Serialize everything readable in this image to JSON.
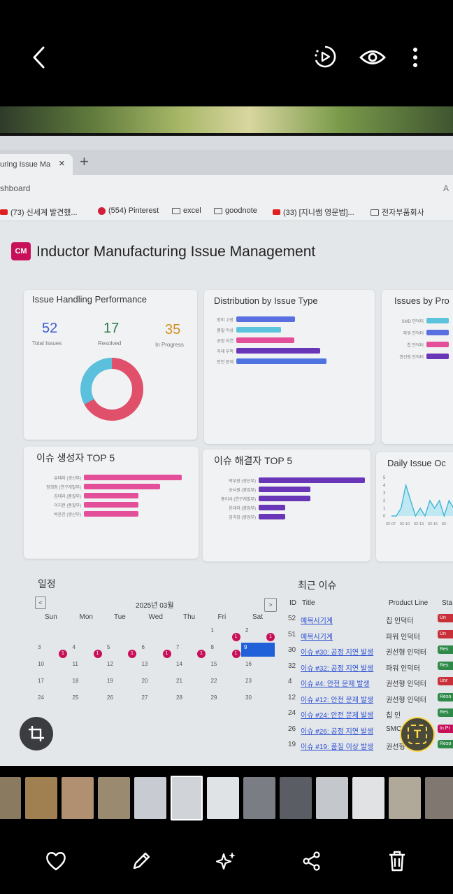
{
  "browser": {
    "tab_title": "uring Issue Ma",
    "tab_close": "×",
    "new_tab": "+",
    "address": "shboard",
    "address_right": "A",
    "bookmarks": [
      {
        "icon": "youtube-icon",
        "label": "(73) 신세계 발견했..."
      },
      {
        "icon": "pinterest-icon",
        "label": "(554) Pinterest"
      },
      {
        "icon": "folder-icon",
        "label": "excel"
      },
      {
        "icon": "folder-icon",
        "label": "goodnote"
      },
      {
        "icon": "youtube-icon",
        "label": "(33) [지니쌤 영문법]..."
      },
      {
        "icon": "folder-icon",
        "label": "전자부품회사"
      }
    ]
  },
  "app": {
    "logo": "CM",
    "title": "Inductor Manufacturing Issue Management"
  },
  "performance": {
    "title": "Issue Handling Performance",
    "total": "52",
    "total_label": "Total Issues",
    "resolved": "17",
    "resolved_label": "Resolved",
    "in_progress": "35",
    "in_progress_label": "In Progress",
    "donut": {
      "resolved_fraction": 0.33,
      "in_progress_fraction": 0.67
    }
  },
  "by_type": {
    "title": "Distribution by Issue Type",
    "items": [
      {
        "label": "장비 고장",
        "value": 0.6,
        "color": "#5a6fe0"
      },
      {
        "label": "품질 이상",
        "value": 0.46,
        "color": "#5bc4dc"
      },
      {
        "label": "공정 지연",
        "value": 0.59,
        "color": "#e44f9a"
      },
      {
        "label": "자재 부족",
        "value": 0.86,
        "color": "#6a36b8"
      },
      {
        "label": "안전 문제",
        "value": 0.92,
        "color": "#4f74e0"
      }
    ]
  },
  "by_product": {
    "title": "Issues by Pro",
    "items": [
      {
        "label": "SMD 인덕터",
        "value": 0.9,
        "color": "#5bc4dc"
      },
      {
        "label": "파워 인덕터",
        "value": 0.9,
        "color": "#5a6fe0"
      },
      {
        "label": "칩 인덕터",
        "value": 0.9,
        "color": "#e44f9a"
      },
      {
        "label": "권선형 인덕터",
        "value": 0.9,
        "color": "#6a36b8"
      }
    ]
  },
  "creators": {
    "title": "이슈 생성자 TOP 5",
    "items": [
      {
        "label": "유태리 (생산부)",
        "value": 1.0
      },
      {
        "label": "정희정 (연구개발부)",
        "value": 0.78
      },
      {
        "label": "김태리 (품질부)",
        "value": 0.56
      },
      {
        "label": "이지현 (품질부)",
        "value": 0.56
      },
      {
        "label": "박윤진 (생산부)",
        "value": 0.56
      }
    ]
  },
  "resolvers": {
    "title": "이슈 해결자 TOP 5",
    "items": [
      {
        "label": "박부장 (생산부)",
        "value": 1.0
      },
      {
        "label": "송사원 (영업부)",
        "value": 0.49
      },
      {
        "label": "홍이사 (연구개발부)",
        "value": 0.49
      },
      {
        "label": "윤대리 (영업부)",
        "value": 0.25
      },
      {
        "label": "김과장 (영업부)",
        "value": 0.25
      }
    ]
  },
  "daily": {
    "title": "Daily Issue Oc",
    "y_ticks": [
      "5",
      "4",
      "3",
      "2",
      "1",
      "0"
    ],
    "x_ticks": [
      "02-07",
      "02-10",
      "02-13",
      "02-16",
      "02-"
    ],
    "values": [
      0,
      0,
      1,
      4,
      2,
      0,
      1,
      0,
      2,
      1,
      2,
      0,
      2,
      1,
      0
    ]
  },
  "calendar": {
    "title": "일정",
    "month": "2025년 03월",
    "prev": "<",
    "next": ">",
    "weekdays": [
      "Sun",
      "Mon",
      "Tue",
      "Wed",
      "Thu",
      "Fri",
      "Sat"
    ],
    "weeks": [
      [
        "",
        "",
        "",
        "",
        "",
        "1",
        "2"
      ],
      [
        "3",
        "4",
        "5",
        "6",
        "7",
        "8",
        "9"
      ],
      [
        "10",
        "11",
        "12",
        "13",
        "14",
        "15",
        "16"
      ],
      [
        "17",
        "18",
        "19",
        "20",
        "21",
        "22",
        "23"
      ],
      [
        "24",
        "25",
        "26",
        "27",
        "28",
        "29",
        "30"
      ]
    ],
    "event_count": "1",
    "today": "9"
  },
  "recent": {
    "title": "최근 이슈",
    "headers": [
      "ID",
      "Title",
      "Product Line",
      "Sta"
    ],
    "rows": [
      {
        "id": "52",
        "title": "예목시기계",
        "line": "칩 인덕터",
        "status": "Un",
        "color": "#c8303a"
      },
      {
        "id": "51",
        "title": "예목시기계",
        "line": "파워 인덕터",
        "status": "Un",
        "color": "#c8303a"
      },
      {
        "id": "30",
        "title": "이슈 #30: 공정 지연 발생",
        "line": "권선형 인덕터",
        "status": "Res",
        "color": "#2f8a4a"
      },
      {
        "id": "32",
        "title": "이슈 #32: 공정 지연 발생",
        "line": "파워 인덕터",
        "status": "Res",
        "color": "#2f8a4a"
      },
      {
        "id": "4",
        "title": "이슈 #4: 안전 문제 발생",
        "line": "권선형 인덕터",
        "status": "Unr",
        "color": "#c8303a"
      },
      {
        "id": "12",
        "title": "이슈 #12: 안전 문제 발생",
        "line": "권선형 인덕터",
        "status": "Reso",
        "color": "#2f8a4a"
      },
      {
        "id": "24",
        "title": "이슈 #24: 안전 문제 발생",
        "line": "칩 인",
        "status": "Res",
        "color": "#2f8a4a"
      },
      {
        "id": "26",
        "title": "이슈 #26: 공정 지연 발생",
        "line": "SMC",
        "status": "In Pr",
        "color": "#c8105a"
      },
      {
        "id": "19",
        "title": "이슈 #19: 품질 이상 발생",
        "line": "권선형 인덕터",
        "status": "Reso",
        "color": "#2f8a4a"
      }
    ]
  },
  "viewer": {
    "back": "back-arrow-icon",
    "text_extract": "T"
  }
}
